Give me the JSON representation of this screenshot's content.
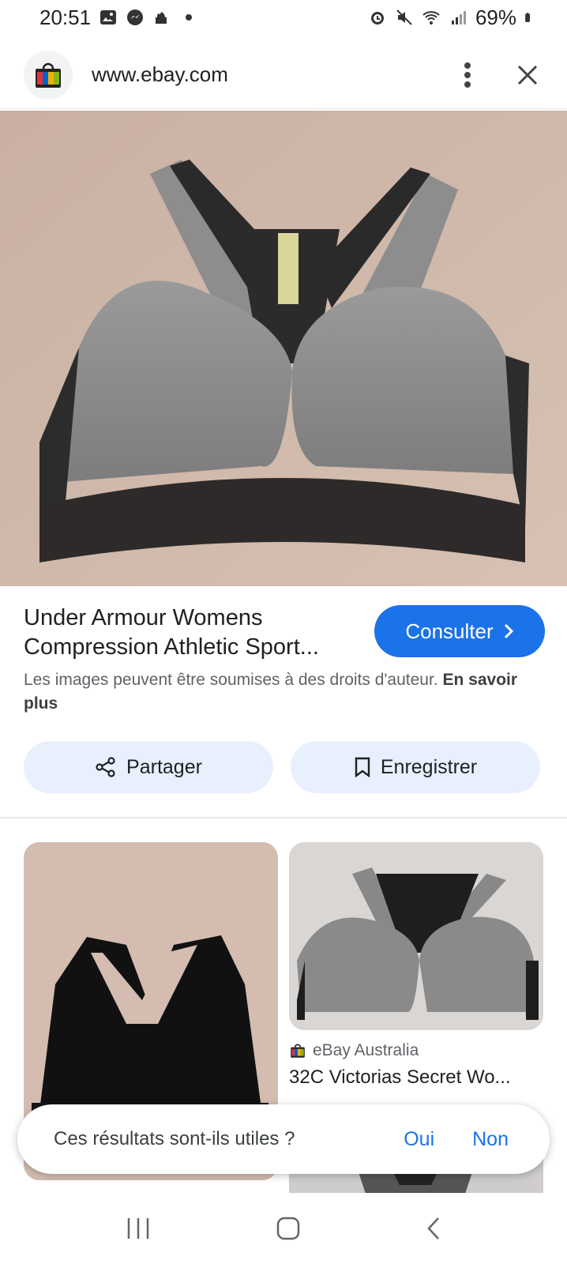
{
  "status_bar": {
    "time": "20:51",
    "battery": "69%",
    "icons_left": [
      "image-icon",
      "messenger-icon",
      "mosque-icon",
      "dot-icon"
    ],
    "icons_right": [
      "alarm-icon",
      "mute-icon",
      "wifi-icon",
      "signal-icon",
      "battery-icon"
    ]
  },
  "url_bar": {
    "url": "www.ebay.com",
    "site_icon": "ebay-shopping-bag-icon",
    "menu_icon": "more-vert-icon",
    "close_icon": "close-icon"
  },
  "result": {
    "title": "Under Armour Womens Compression Athletic Sport...",
    "consulter_label": "Consulter",
    "copyright_text": "Les images peuvent être soumises à des droits d'auteur.",
    "learn_more": "En savoir plus"
  },
  "actions": {
    "share_label": "Partager",
    "save_label": "Enregistrer"
  },
  "related": [
    {
      "source": "eBay Australia",
      "title": "32C Victorias Secret Wo..."
    }
  ],
  "feedback": {
    "question": "Ces résultats sont-ils utiles ?",
    "yes": "Oui",
    "no": "Non"
  },
  "colors": {
    "accent": "#1a73e8",
    "chip_bg": "#e8f0fe"
  }
}
